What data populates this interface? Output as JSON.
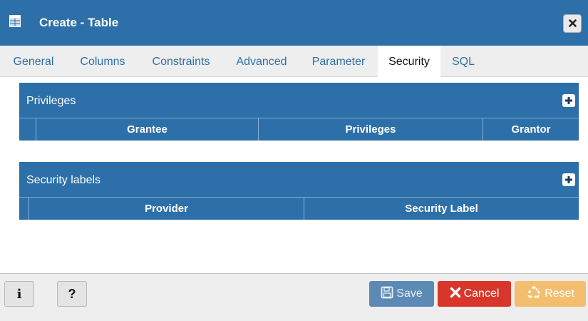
{
  "dialog": {
    "title": "Create - Table",
    "close_label": "×"
  },
  "tabs": [
    {
      "label": "General"
    },
    {
      "label": "Columns"
    },
    {
      "label": "Constraints"
    },
    {
      "label": "Advanced"
    },
    {
      "label": "Parameter"
    },
    {
      "label": "Security",
      "active": true
    },
    {
      "label": "SQL"
    }
  ],
  "privileges": {
    "title": "Privileges",
    "columns": [
      "Grantee",
      "Privileges",
      "Grantor"
    ],
    "rows": []
  },
  "security_labels": {
    "title": "Security labels",
    "columns": [
      "Provider",
      "Security Label"
    ],
    "rows": []
  },
  "footer": {
    "info_label": "i",
    "help_label": "?",
    "save_label": "Save",
    "cancel_label": "Cancel",
    "reset_label": "Reset"
  },
  "colors": {
    "primary": "#2d6fa9",
    "danger": "#d9362b",
    "warning": "#f3bf6e"
  }
}
